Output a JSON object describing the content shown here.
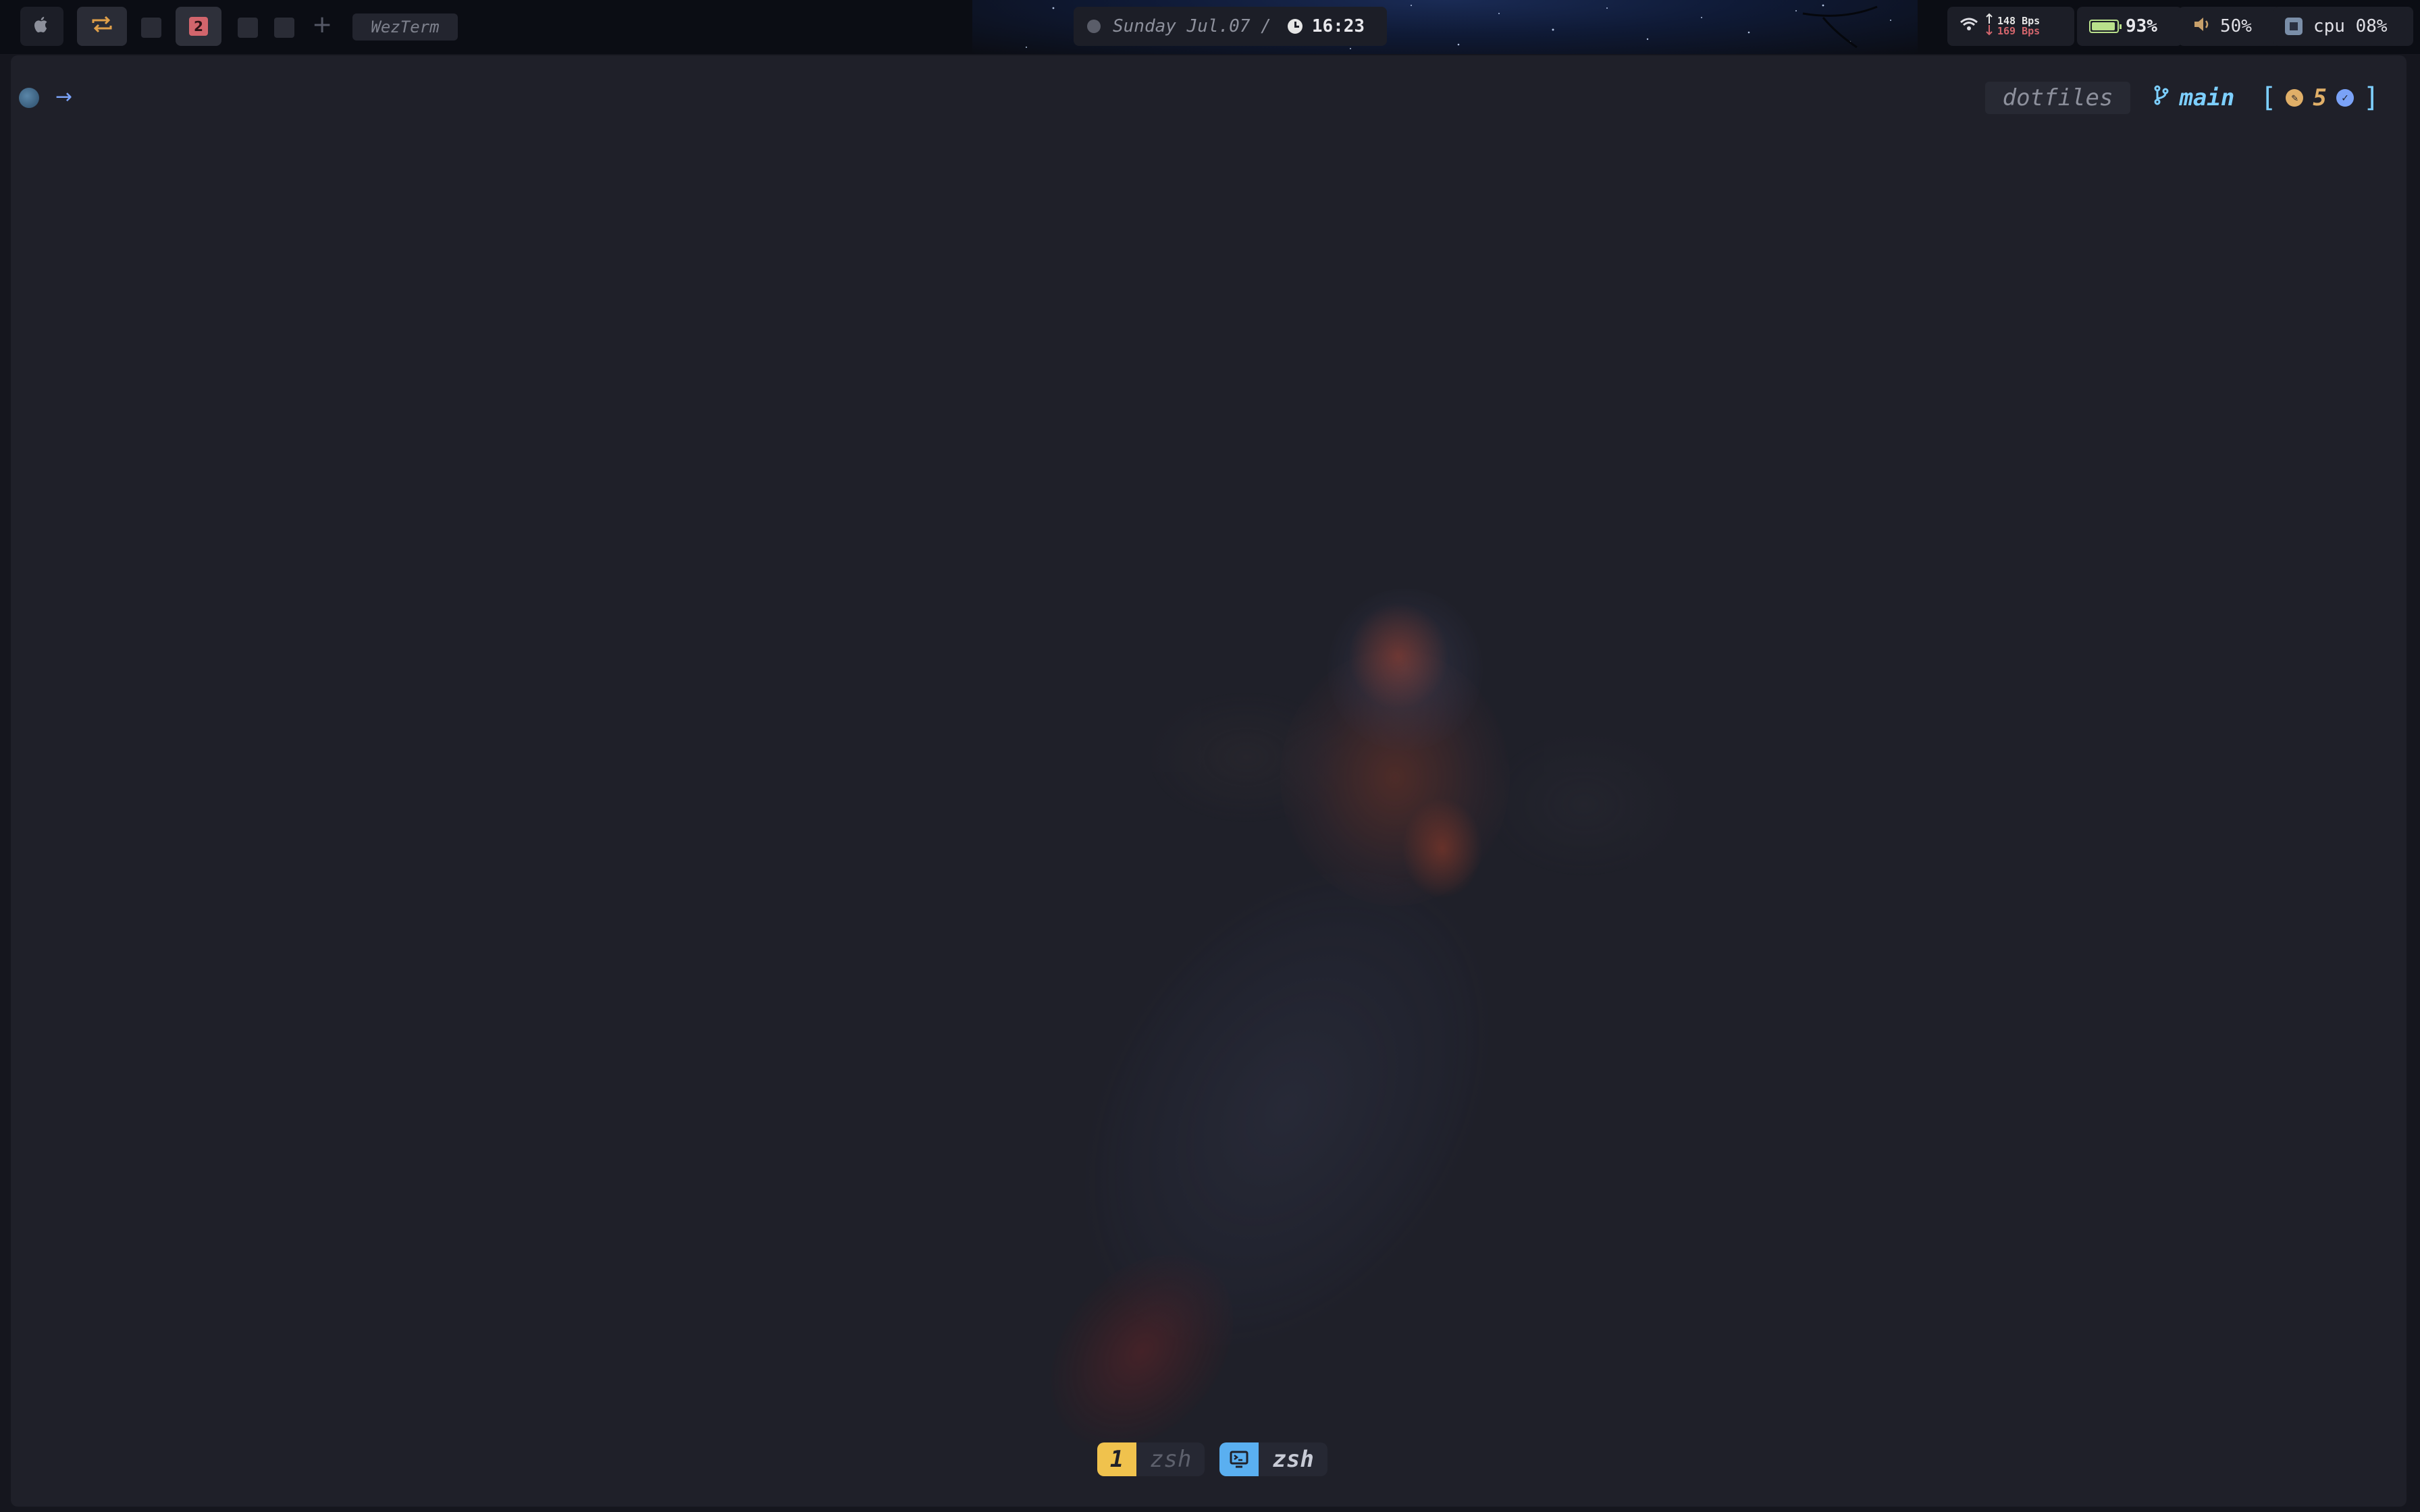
{
  "menubar": {
    "apple_icon": "apple-icon",
    "sync_icon": "sync-icon",
    "workspaces": [
      {
        "id": "1",
        "label": ""
      },
      {
        "id": "2",
        "label": "2"
      },
      {
        "id": "3",
        "label": ""
      },
      {
        "id": "4",
        "label": ""
      }
    ],
    "add_label": "+",
    "front_app": "WezTerm",
    "date": "Sunday Jul.07 /",
    "time": "16:23",
    "net_up": "148 Bps",
    "net_down": "169 Bps",
    "battery": "93%",
    "volume": "50%",
    "cpu": "cpu 08%",
    "colors": {
      "accent_red": "#d2656c",
      "net_up": "#e6e6e6",
      "net_down": "#d2656c",
      "battery": "#b9e08b"
    }
  },
  "terminal": {
    "prompt_symbol": "→",
    "directory": "dotfiles",
    "git_branch": "main",
    "git_bracket_open": "[",
    "git_bracket_close": "]",
    "git_count": "5",
    "tabs": [
      {
        "index": "1",
        "title": "zsh",
        "active": false,
        "index_color": "#f0c24d"
      },
      {
        "index": "🖳",
        "title": "zsh",
        "active": true,
        "index_color": "#5aaff0"
      }
    ],
    "colors": {
      "background": "#1f2029",
      "branch": "#7dcfff",
      "count": "#e0af68"
    }
  }
}
